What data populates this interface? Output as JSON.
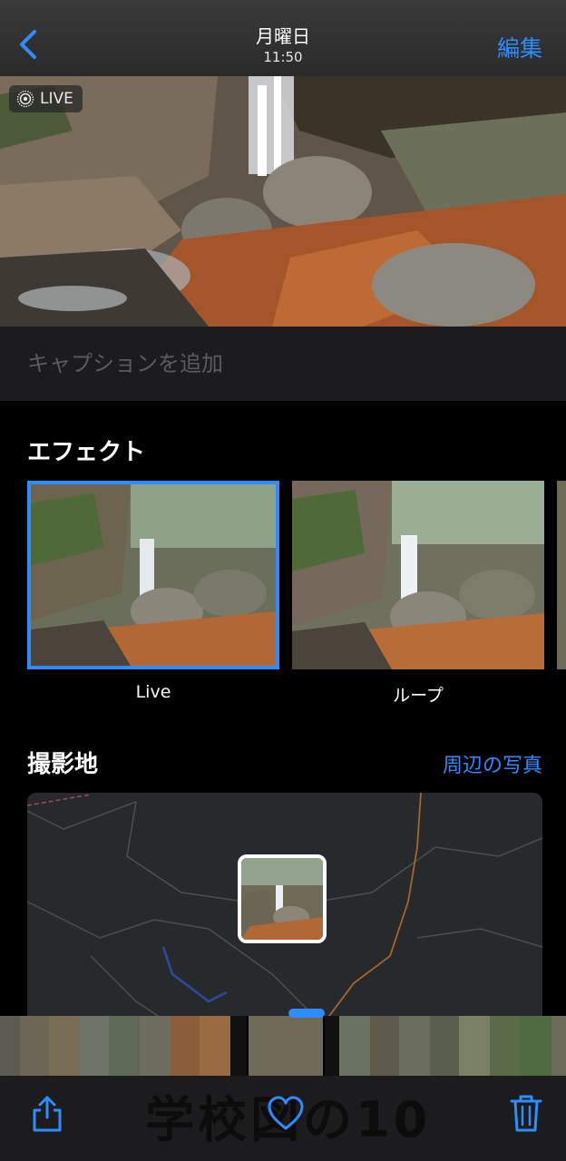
{
  "nav": {
    "title": "月曜日",
    "time": "11:50",
    "edit_label": "編集"
  },
  "hero": {
    "live_label": "LIVE"
  },
  "caption": {
    "placeholder": "キャプションを追加",
    "value": ""
  },
  "effects": {
    "title": "エフェクト",
    "items": [
      {
        "label": "Live",
        "selected": true
      },
      {
        "label": "ループ",
        "selected": false
      }
    ]
  },
  "location": {
    "title": "撮影地",
    "nearby_label": "周辺の写真"
  },
  "toolbar": {
    "share_icon": "share-icon",
    "favorite_icon": "heart-icon",
    "delete_icon": "trash-icon",
    "watermark": "学校図の10"
  },
  "colors": {
    "accent": "#2e8cff",
    "background": "#000000",
    "panel": "#1c1c1e",
    "map_background": "#272a2c"
  }
}
